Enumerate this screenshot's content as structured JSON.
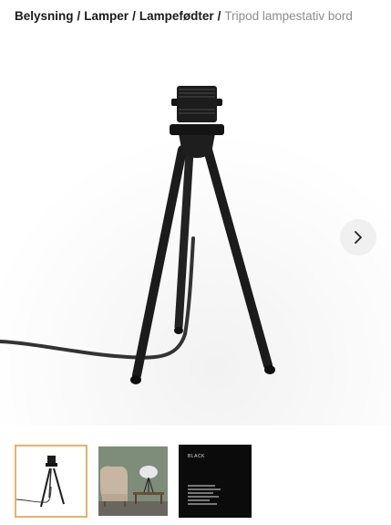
{
  "breadcrumb": {
    "items": [
      "Belysning",
      "Lamper",
      "Lampefødter"
    ],
    "separator": "/",
    "current": "Tripod lampestativ bord"
  },
  "gallery": {
    "main_image": "tripod-table-lamp-stand-black",
    "next_icon": "chevron-right-icon",
    "thumbnails": [
      {
        "name": "tripod-front",
        "active": true
      },
      {
        "name": "lifestyle-room",
        "active": false
      },
      {
        "name": "color-swatch-black",
        "active": false,
        "label": "BLACK"
      }
    ]
  },
  "colors": {
    "active_thumb_border": "#e8b26a",
    "breadcrumb_current": "#8c8c8c",
    "product": "#1b1b1b"
  }
}
